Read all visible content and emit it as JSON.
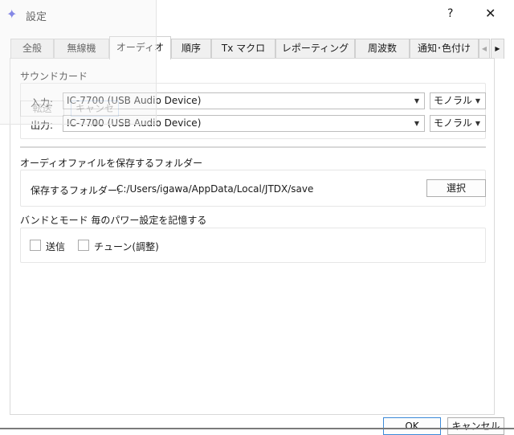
{
  "window": {
    "title": "設定",
    "help": "?",
    "close": "✕"
  },
  "tabs": [
    "全般",
    "無線機",
    "オーディオ",
    "順序",
    "Tx マクロ",
    "レポーティング",
    "周波数",
    "通知･色付け"
  ],
  "tab_scroll": {
    "left": "◀",
    "right": "▶"
  },
  "soundcard": {
    "heading": "サウンドカード",
    "input_label": "入力:",
    "input_value": "IC-7700 (USB Audio Device)",
    "input_channel": "モノラル",
    "output_label": "出力:",
    "output_value": "IC-7700 (USB Audio Device)",
    "output_channel": "モノラル"
  },
  "folder": {
    "heading": "オーディオファイルを保存するフォルダー",
    "label": "保存するフォルダー:",
    "path": "C:/Users/igawa/AppData/Local/JTDX/save",
    "select_button": "選択"
  },
  "power": {
    "heading": "バンドとモード 毎のパワー設定を記憶する",
    "tx_label": "送信",
    "tune_label": "チューン(調整)",
    "tx_checked": false,
    "tune_checked": false
  },
  "ghost": {
    "transfer": "転送",
    "cancel": "キャンセル"
  },
  "footer": {
    "ok": "OK",
    "cancel": "キャンセル"
  }
}
